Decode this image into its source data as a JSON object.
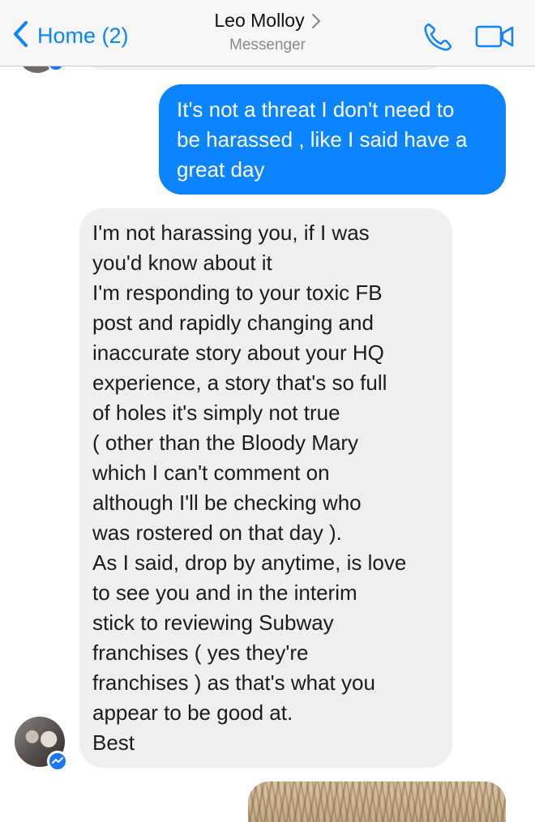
{
  "navbar": {
    "back_label": "Home (2)",
    "contact_name": "Leo Molloy",
    "subtitle": "Messenger",
    "icons": {
      "back": "chevron-left-icon",
      "title": "chevron-right-icon",
      "call": "phone-icon",
      "video": "video-camera-icon"
    },
    "accent_color": "#0a84ff"
  },
  "messages": [
    {
      "direction": "outgoing",
      "lines": [
        "It's not a threat I don't need to",
        "be harassed , like I said have a",
        "great day"
      ]
    },
    {
      "direction": "incoming",
      "lines": [
        "I'm not harassing you, if I was",
        "you'd know about it",
        "I'm responding to your toxic FB",
        "post and rapidly changing and",
        "inaccurate story about your HQ",
        "experience, a story that's so full",
        "of holes it's simply not true",
        "( other than the Bloody Mary",
        "which I can't comment on",
        "although I'll be checking who",
        "was rostered on that day ).",
        "As I said, drop by anytime, is love",
        "to see you and in the interim",
        "stick to reviewing Subway",
        "franchises ( yes they're",
        "franchises ) as that's what you",
        "appear to be good at.",
        "Best"
      ]
    },
    {
      "direction": "outgoing",
      "type": "image"
    }
  ],
  "colors": {
    "outgoing_bubble": "#0a84ff",
    "incoming_bubble": "#efeff1",
    "messenger_badge": "#1877f2"
  }
}
